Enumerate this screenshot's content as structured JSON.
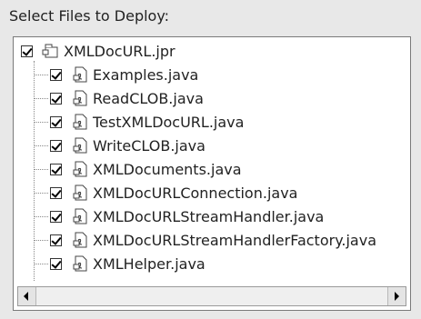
{
  "heading": "Select Files to Deploy:",
  "tree": {
    "root": {
      "label": "XMLDocURL.jpr",
      "checked": true,
      "icon": "project-file-icon"
    },
    "children": [
      {
        "label": "Examples.java",
        "checked": true,
        "icon": "java-file-icon"
      },
      {
        "label": "ReadCLOB.java",
        "checked": true,
        "icon": "java-file-icon"
      },
      {
        "label": "TestXMLDocURL.java",
        "checked": true,
        "icon": "java-file-icon"
      },
      {
        "label": "WriteCLOB.java",
        "checked": true,
        "icon": "java-file-icon"
      },
      {
        "label": "XMLDocuments.java",
        "checked": true,
        "icon": "java-file-icon"
      },
      {
        "label": "XMLDocURLConnection.java",
        "checked": true,
        "icon": "java-file-icon"
      },
      {
        "label": "XMLDocURLStreamHandler.java",
        "checked": true,
        "icon": "java-file-icon"
      },
      {
        "label": "XMLDocURLStreamHandlerFactory.java",
        "checked": true,
        "icon": "java-file-icon"
      },
      {
        "label": "XMLHelper.java",
        "checked": true,
        "icon": "java-file-icon"
      }
    ]
  },
  "scrollbar": {
    "left_icon": "scroll-left-arrow-icon",
    "right_icon": "scroll-right-arrow-icon"
  }
}
